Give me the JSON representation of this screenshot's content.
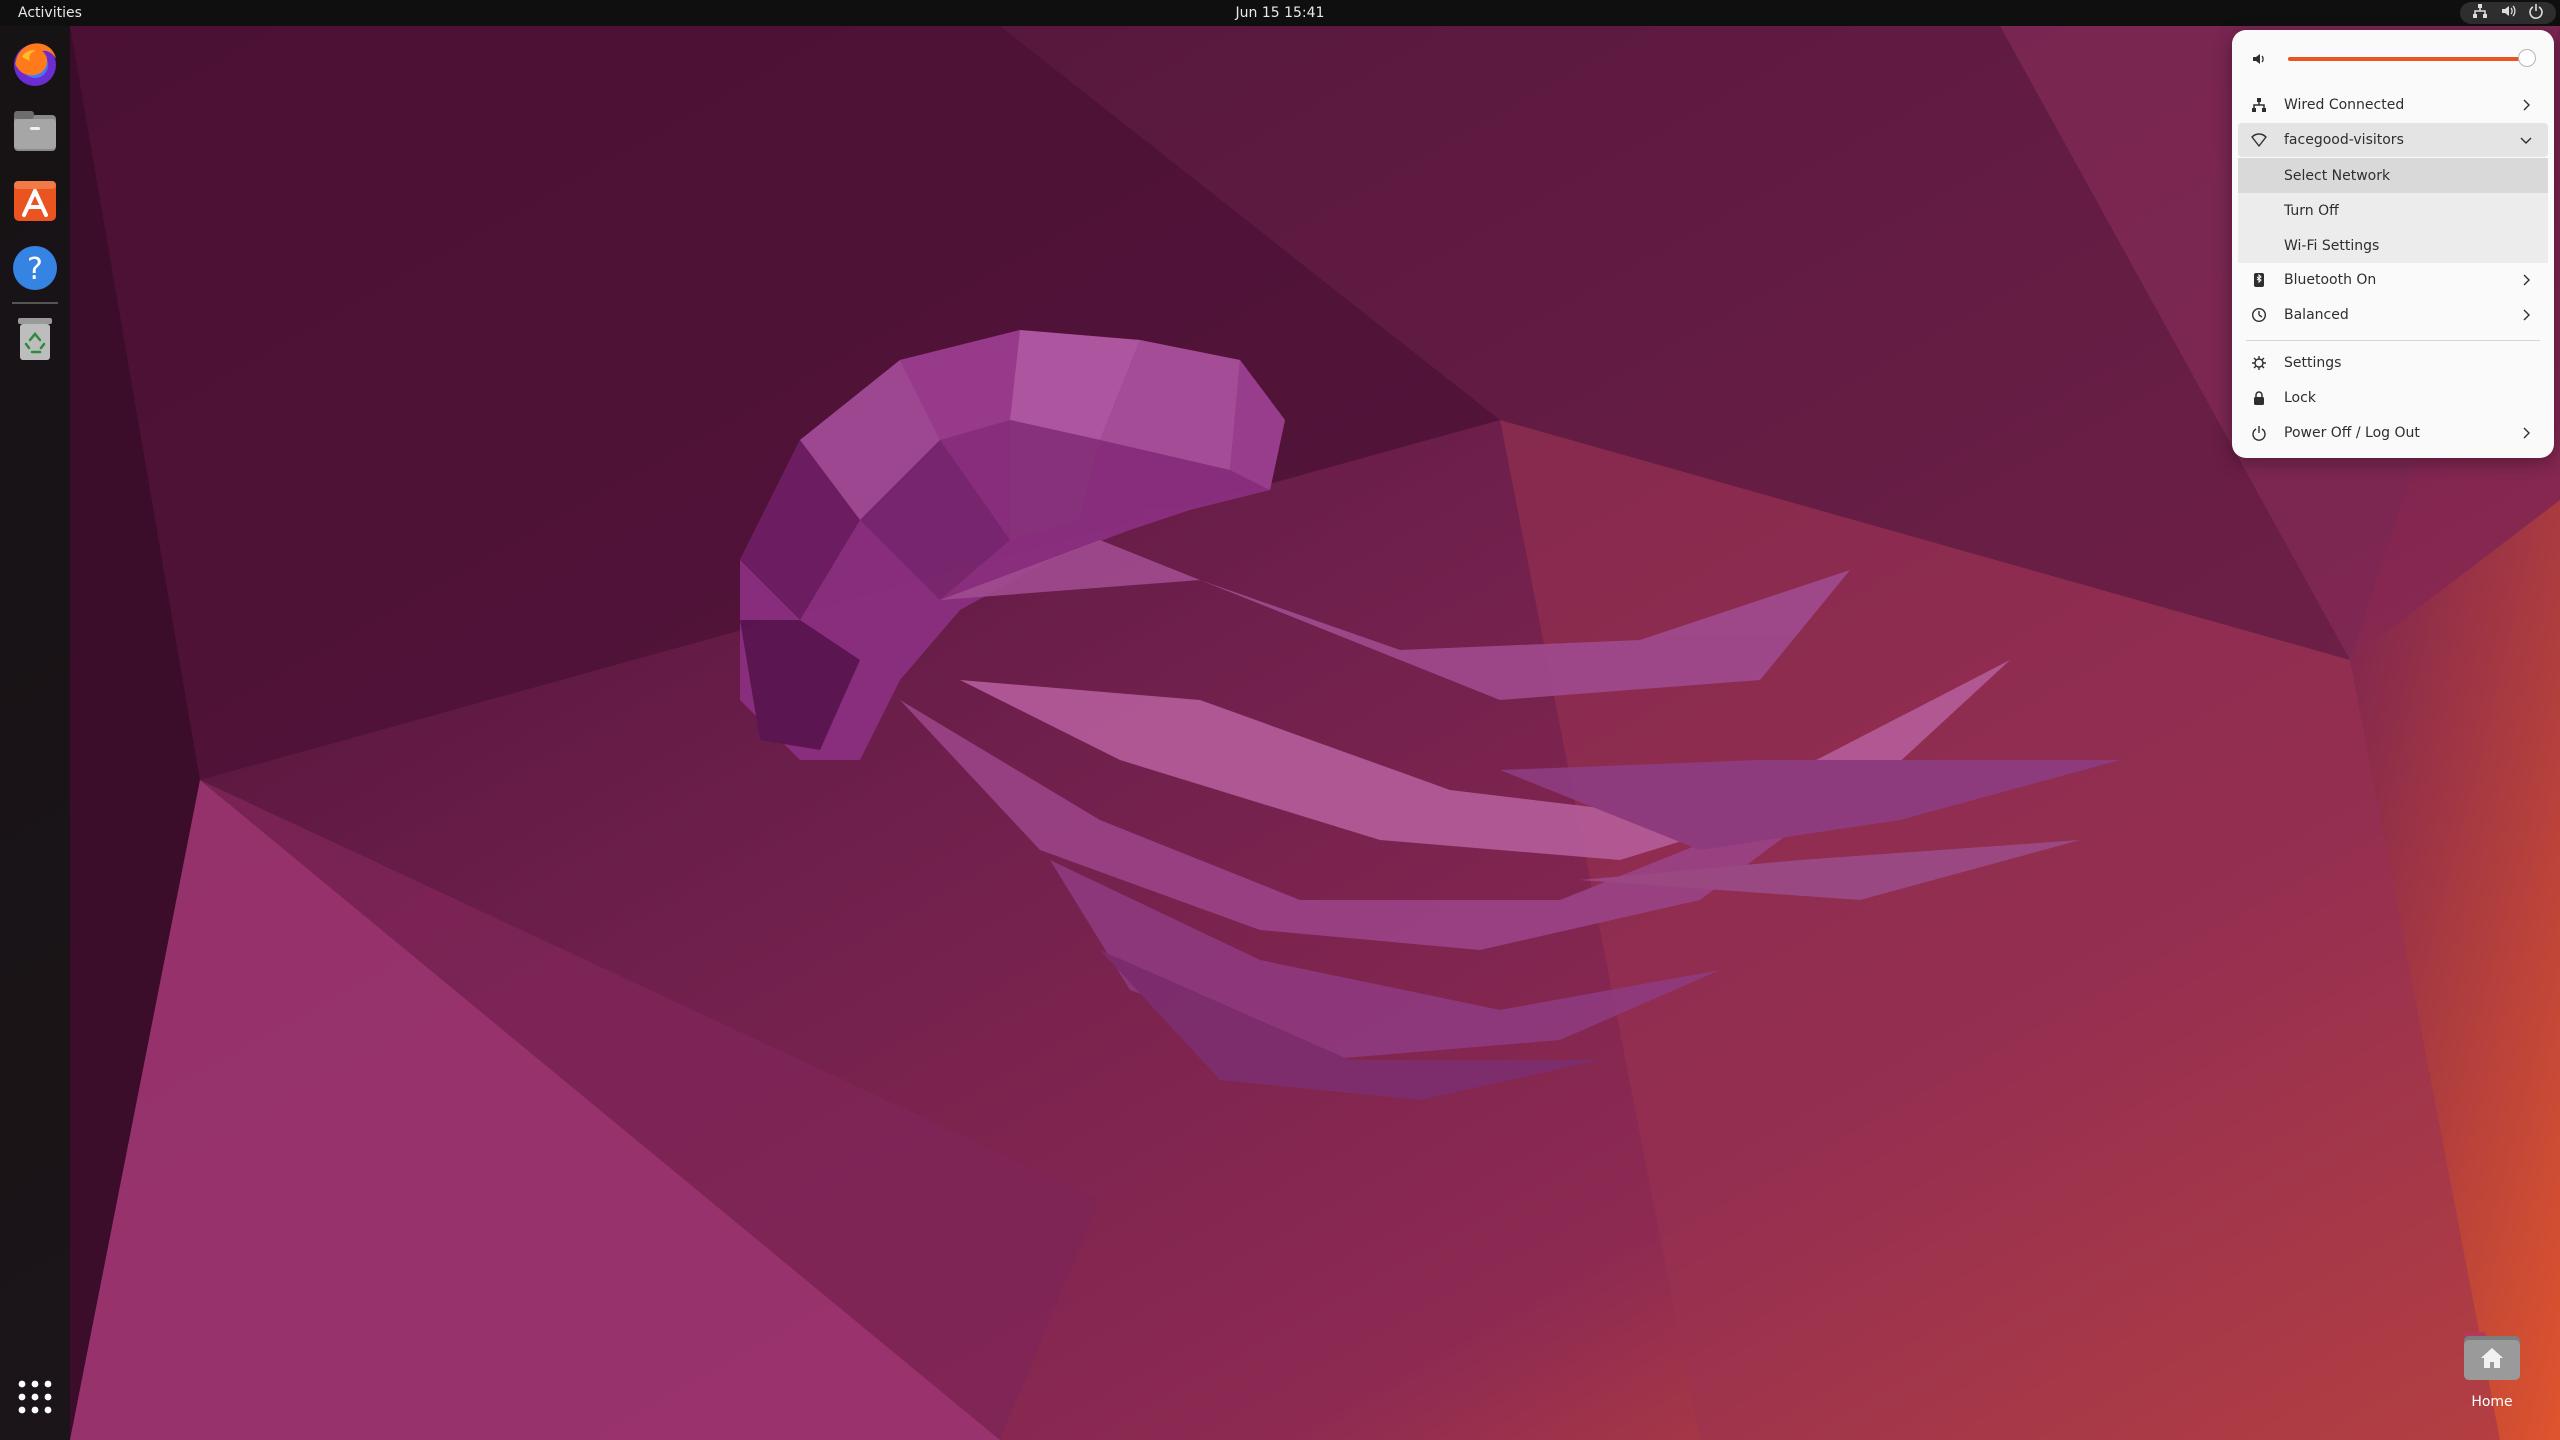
{
  "topbar": {
    "activities_label": "Activities",
    "clock": "Jun 15  15:41",
    "tray_icons": [
      "network-icon",
      "volume-icon",
      "power-icon"
    ]
  },
  "dock": {
    "items": [
      {
        "name": "Firefox",
        "icon": "firefox-icon"
      },
      {
        "name": "Files",
        "icon": "files-icon"
      },
      {
        "name": "Ubuntu Software",
        "icon": "software-icon"
      },
      {
        "name": "Help",
        "icon": "help-icon"
      },
      {
        "name": "Trash",
        "icon": "trash-icon"
      }
    ],
    "apps_grid_icon": "apps-grid-icon"
  },
  "quick_settings": {
    "volume": {
      "icon": "volume-icon",
      "level_percent": 98
    },
    "wired": {
      "label": "Wired Connected",
      "icon": "wired-network-icon"
    },
    "wifi": {
      "label": "facegood-visitors",
      "icon": "wifi-icon",
      "submenu": [
        "Select Network",
        "Turn Off",
        "Wi-Fi Settings"
      ]
    },
    "bluetooth": {
      "label": "Bluetooth On",
      "icon": "bluetooth-icon"
    },
    "power_mode": {
      "label": "Balanced",
      "icon": "power-mode-icon"
    },
    "settings": {
      "label": "Settings",
      "icon": "gear-icon"
    },
    "lock": {
      "label": "Lock",
      "icon": "lock-icon"
    },
    "power_off": {
      "label": "Power Off / Log Out",
      "icon": "power-icon"
    }
  },
  "desktop": {
    "home_label": "Home"
  },
  "colors": {
    "accent": "#e95420",
    "topbar": "#0f0f0f",
    "menu_bg": "#fafafa"
  }
}
